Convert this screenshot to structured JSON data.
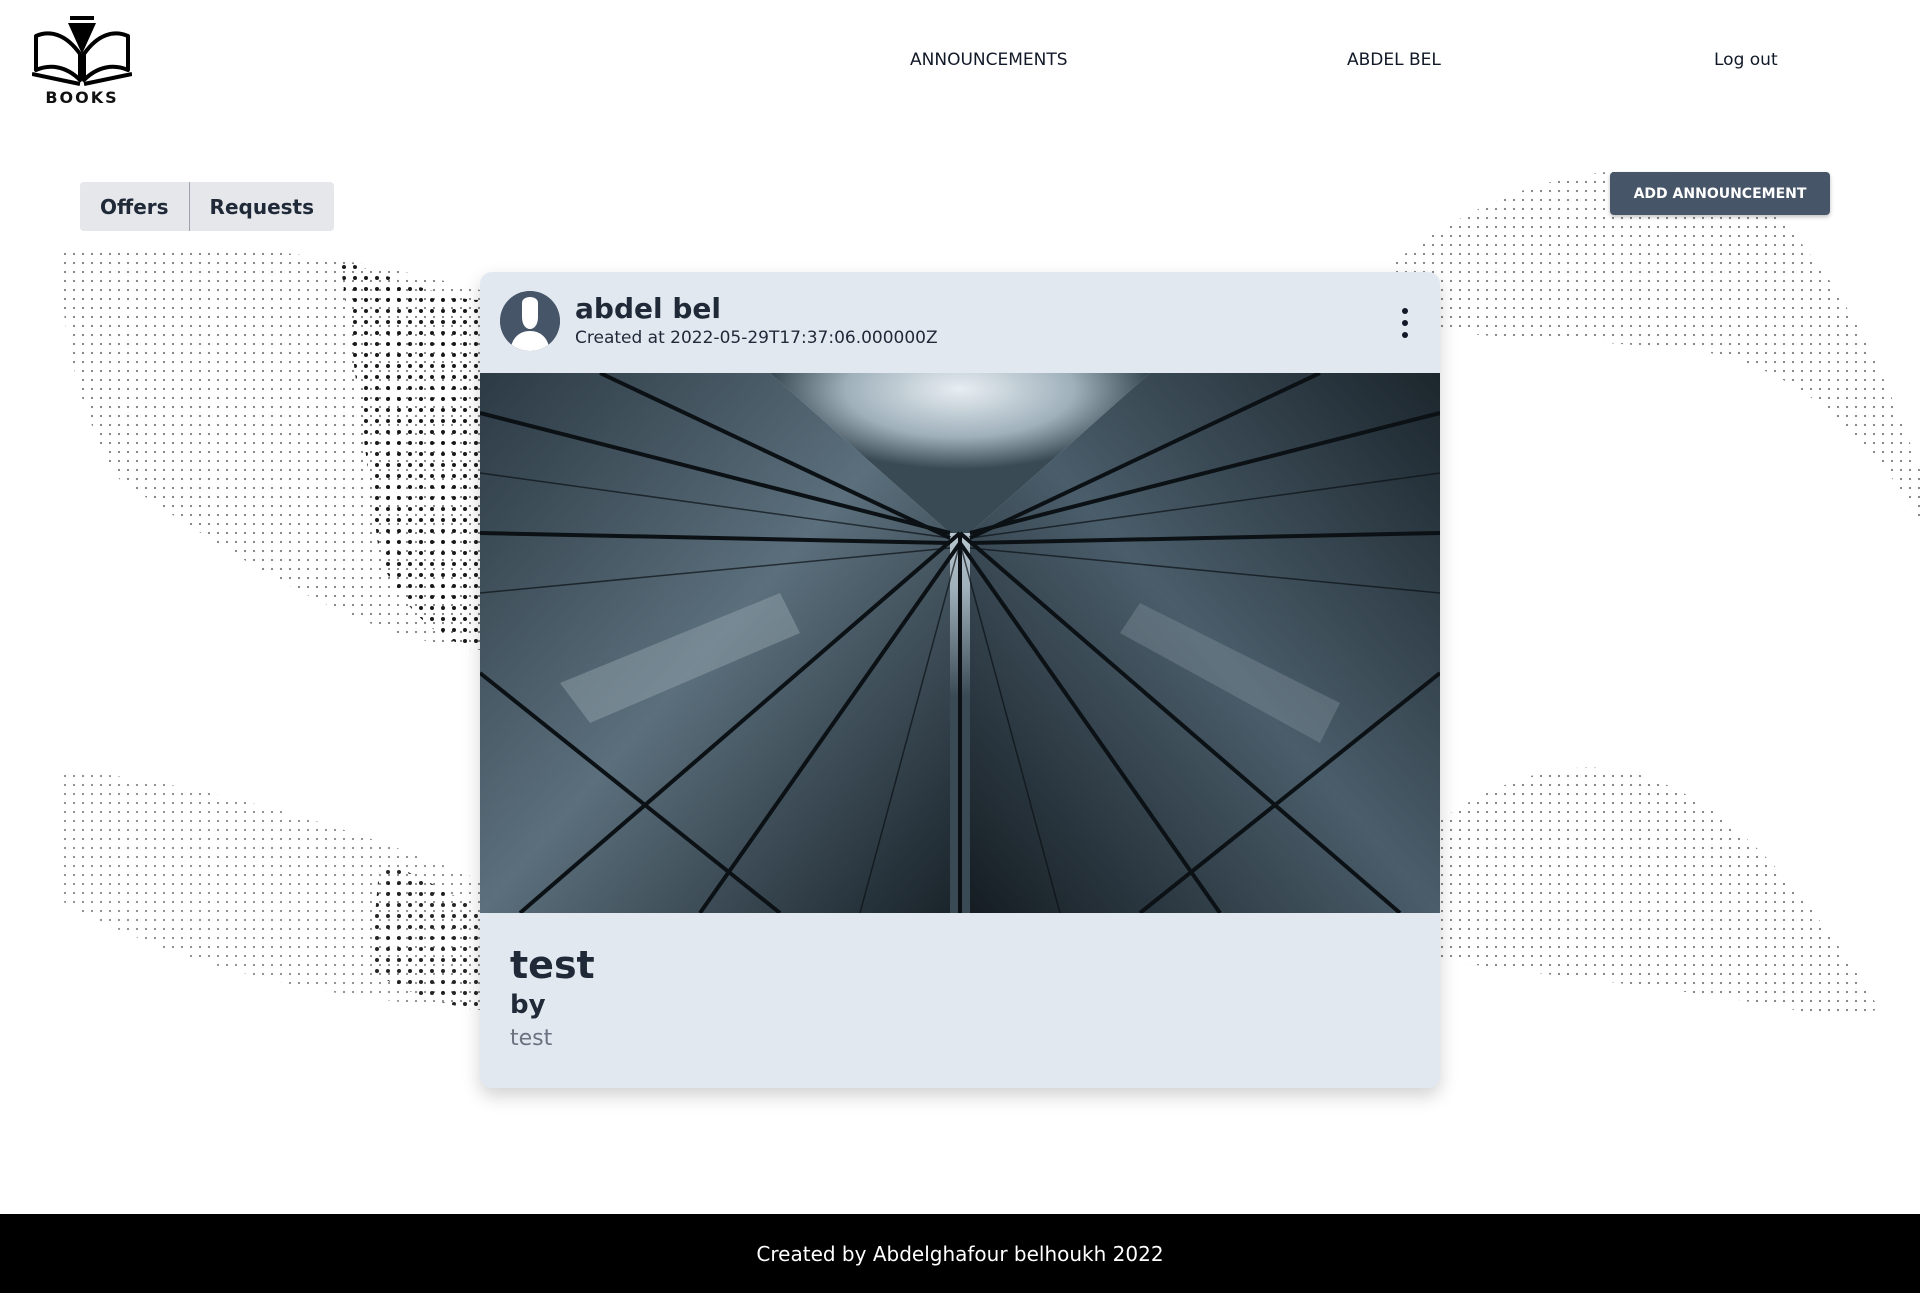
{
  "brand": {
    "logo_text": "BOOKS",
    "icon": "open-book-icon"
  },
  "nav": {
    "announcements": "ANNOUNCEMENTS",
    "user": "ABDEL BEL",
    "logout": "Log out"
  },
  "tabs": [
    {
      "label": "Offers"
    },
    {
      "label": "Requests"
    }
  ],
  "actions": {
    "add_announcement": "ADD ANNOUNCEMENT"
  },
  "announcement": {
    "author": "abdel bel",
    "created": "Created at 2022-05-29T17:37:06.000000Z",
    "title": "test",
    "by": "by",
    "description": "test",
    "avatar_icon": "user-avatar-icon",
    "menu_icon": "kebab-menu-icon"
  },
  "footer": {
    "text": "Created by Abdelghafour belhoukh 2022"
  },
  "colors": {
    "button_bg": "#475569",
    "card_bg": "#e2e8f0",
    "tab_bg": "#e5e7eb",
    "footer_bg": "#000000"
  }
}
